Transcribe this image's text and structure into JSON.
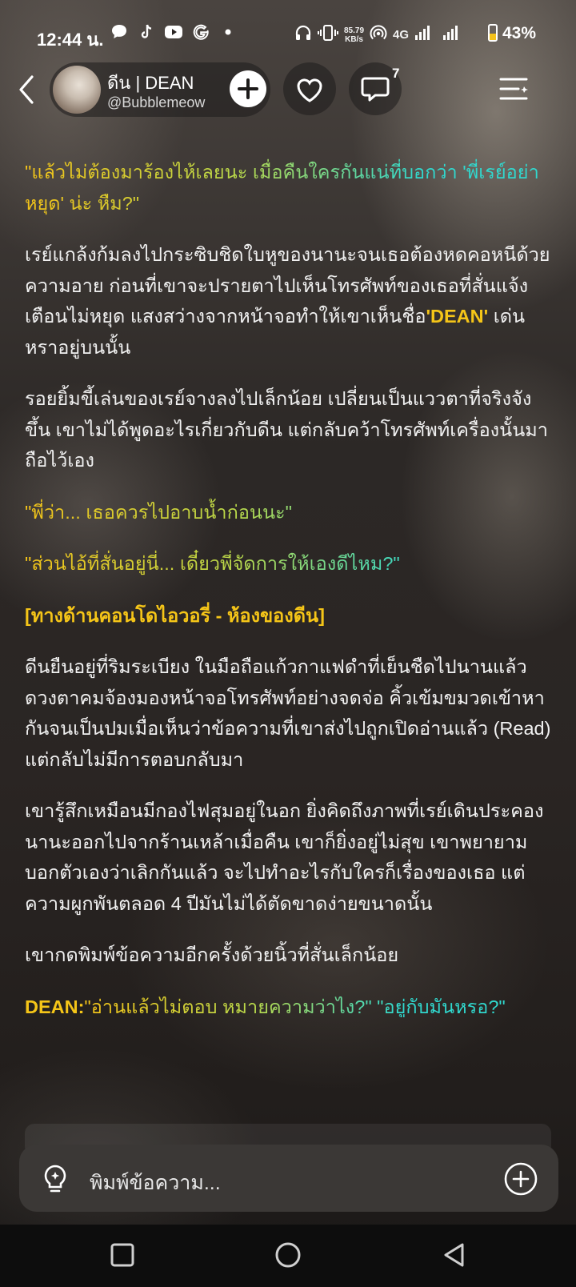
{
  "status_bar": {
    "time": "12:44 น.",
    "net_speed_value": "85.79",
    "net_speed_unit": "KB/s",
    "network": "4G",
    "battery": "43%",
    "battery_level": 0.43,
    "icons_left": [
      "chat-bubble-icon",
      "tiktok-icon",
      "youtube-icon",
      "google-icon",
      "dot-icon"
    ],
    "icons_right": [
      "headphones-icon",
      "vibrate-icon",
      "hotspot-icon",
      "signal-icon",
      "signal-icon",
      "battery-icon"
    ]
  },
  "header": {
    "author_name": "ดีน | DEAN",
    "author_handle": "@Bubblemeow",
    "comment_count": "7"
  },
  "story": {
    "p1": "\"แล้วไม่ต้องมาร้องไห้เลยนะ เมื่อคืนใครกันแน่ที่บอกว่า 'พี่เรย์อย่าหยุด' น่ะ หืม?\"",
    "p2_before": "เรย์แกล้งก้มลงไปกระซิบชิดใบหูของนานะจนเธอต้องหดคอหนีด้วยความอาย ก่อนที่เขาจะปรายตาไปเห็นโทรศัพท์ของเธอที่สั่นแจ้งเตือนไม่หยุด แสงสว่างจากหน้าจอทำให้เขาเห็นชื่อ",
    "p2_name": "'DEAN'",
    "p2_after": " เด่นหราอยู่บนนั้น",
    "p3": "รอยยิ้มขี้เล่นของเรย์จางลงไปเล็กน้อย เปลี่ยนเป็นแววตาที่จริงจังขึ้น เขาไม่ได้พูดอะไรเกี่ยวกับดีน แต่กลับคว้าโทรศัพท์เครื่องนั้นมาถือไว้เอง",
    "p4": "\"พี่ว่า... เธอควรไปอาบน้ำก่อนนะ\"",
    "p5": "\"ส่วนไอ้ที่สั่นอยู่นี่... เดี๋ยวพี่จัดการให้เองดีไหม?\"",
    "p6": "[ทางด้านคอนโดไอวอรี่ - ห้องของดีน]",
    "p7": "ดีนยืนอยู่ที่ริมระเบียง ในมือถือแก้วกาแฟดำที่เย็นชืดไปนานแล้ว ดวงตาคมจ้องมองหน้าจอโทรศัพท์อย่างจดจ่อ คิ้วเข้มขมวดเข้าหากันจนเป็นปมเมื่อเห็นว่าข้อความที่เขาส่งไปถูกเปิดอ่านแล้ว (Read) แต่กลับไม่มีการตอบกลับมา",
    "p8": "เขารู้สึกเหมือนมีกองไฟสุมอยู่ในอก ยิ่งคิดถึงภาพที่เรย์เดินประคองนานะออกไปจากร้านเหล้าเมื่อคืน เขาก็ยิ่งอยู่ไม่สุข เขาพยายามบอกตัวเองว่าเลิกกันแล้ว จะไปทำอะไรกับใครก็เรื่องของเธอ แต่ความผูกพันตลอด 4 ปีมันไม่ได้ตัดขาดง่ายขนาดนั้น",
    "p9": "เขากดพิมพ์ข้อความอีกครั้งด้วยนิ้วที่สั่นเล็กน้อย",
    "p10_speaker": "DEAN:",
    "p10_text": "\"อ่านแล้วไม่ตอบ หมายความว่าไง?\" \"อยู่กับมันหรอ?\""
  },
  "composer": {
    "placeholder": "พิมพ์ข้อความ..."
  },
  "colors": {
    "gold": "#f5c518",
    "teal": "#30d9cf",
    "composer_bg": "#3b3836"
  }
}
